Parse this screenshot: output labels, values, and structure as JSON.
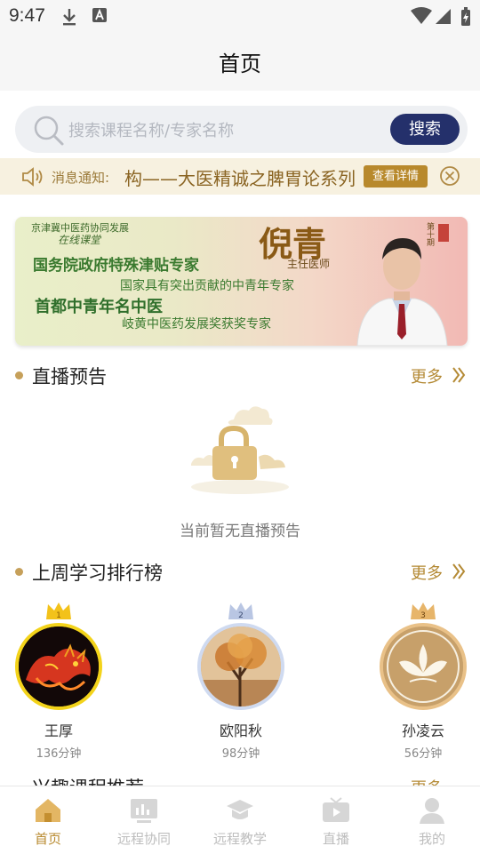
{
  "status_bar": {
    "time": "9:47"
  },
  "header": {
    "title": "首页"
  },
  "search": {
    "placeholder": "搜索课程名称/专家名称",
    "button_label": "搜索"
  },
  "notice": {
    "label": "消息通知:",
    "text": "构——大医精诚之脾胃论系列",
    "detail_button": "查看详情"
  },
  "banner": {
    "line1": "京津冀中医药协同发展",
    "line2": "在线课堂",
    "line3": "国务院政府特殊津贴专家",
    "line4": "国家具有突出贡献的中青年专家",
    "line5": "首都中青年名中医",
    "line6": "岐黄中医药发展奖获奖专家",
    "name": "倪青",
    "subtitle": "主任医师",
    "side_text": "第十期"
  },
  "live_preview": {
    "title": "直播预告",
    "more": "更多",
    "empty_text": "当前暂无直播预告"
  },
  "leaderboard": {
    "title": "上周学习排行榜",
    "more": "更多",
    "ranks": [
      {
        "rank": "1",
        "name": "王厚",
        "minutes": "136分钟",
        "color": "#f3c21a"
      },
      {
        "rank": "2",
        "name": "欧阳秋",
        "minutes": "98分钟",
        "color": "#b9c6e3"
      },
      {
        "rank": "3",
        "name": "孙凌云",
        "minutes": "56分钟",
        "color": "#e7b56a"
      }
    ]
  },
  "next_section": {
    "title": "兴趣课程推荐",
    "more": "更多"
  },
  "tabbar": {
    "items": [
      {
        "label": "首页",
        "active": true
      },
      {
        "label": "远程协同",
        "active": false
      },
      {
        "label": "远程教学",
        "active": false
      },
      {
        "label": "直播",
        "active": false
      },
      {
        "label": "我的",
        "active": false
      }
    ]
  },
  "colors": {
    "accent_gold": "#b88a2f",
    "search_button": "#24306b",
    "notice_bg": "#f7f1e0"
  }
}
